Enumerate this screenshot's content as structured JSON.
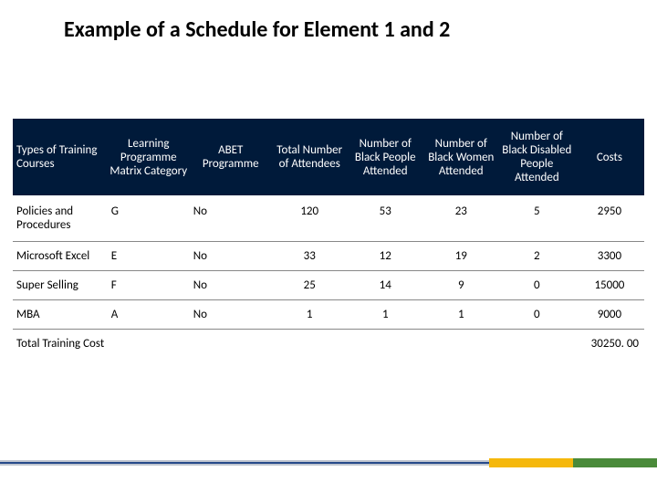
{
  "title": "Example of a Schedule for Element 1 and 2",
  "headers": {
    "c1": "Types of Training Courses",
    "c2": "Learning Programme Matrix Category",
    "c3": "ABET Programme",
    "c4": "Total Number of Attendees",
    "c5": "Number of Black People Attended",
    "c6": "Number of Black Women Attended",
    "c7": "Number of Black Disabled People Attended",
    "c8": "Costs"
  },
  "rows": [
    {
      "name": "Policies and Procedures",
      "cat": "G",
      "abet": "No",
      "total": "120",
      "bp": "53",
      "bw": "23",
      "bd": "5",
      "cost": "2950"
    },
    {
      "name": "Microsoft Excel",
      "cat": "E",
      "abet": "No",
      "total": "33",
      "bp": "12",
      "bw": "19",
      "bd": "2",
      "cost": "3300"
    },
    {
      "name": "Super Selling",
      "cat": "F",
      "abet": "No",
      "total": "25",
      "bp": "14",
      "bw": "9",
      "bd": "0",
      "cost": "15000"
    },
    {
      "name": "MBA",
      "cat": "A",
      "abet": "No",
      "total": "1",
      "bp": "1",
      "bw": "1",
      "bd": "0",
      "cost": "9000"
    }
  ],
  "footer": {
    "label": "Total Training Cost",
    "value": "30250. 00"
  },
  "chart_data": {
    "type": "table",
    "title": "Example of a Schedule for Element 1 and 2",
    "columns": [
      "Types of Training Courses",
      "Learning Programme Matrix Category",
      "ABET Programme",
      "Total Number of Attendees",
      "Number of Black People Attended",
      "Number of Black Women Attended",
      "Number of Black Disabled People Attended",
      "Costs"
    ],
    "data": [
      [
        "Policies and Procedures",
        "G",
        "No",
        120,
        53,
        23,
        5,
        2950
      ],
      [
        "Microsoft Excel",
        "E",
        "No",
        33,
        12,
        19,
        2,
        3300
      ],
      [
        "Super Selling",
        "F",
        "No",
        25,
        14,
        9,
        0,
        15000
      ],
      [
        "MBA",
        "A",
        "No",
        1,
        1,
        1,
        0,
        9000
      ]
    ],
    "total_cost": 30250.0
  }
}
